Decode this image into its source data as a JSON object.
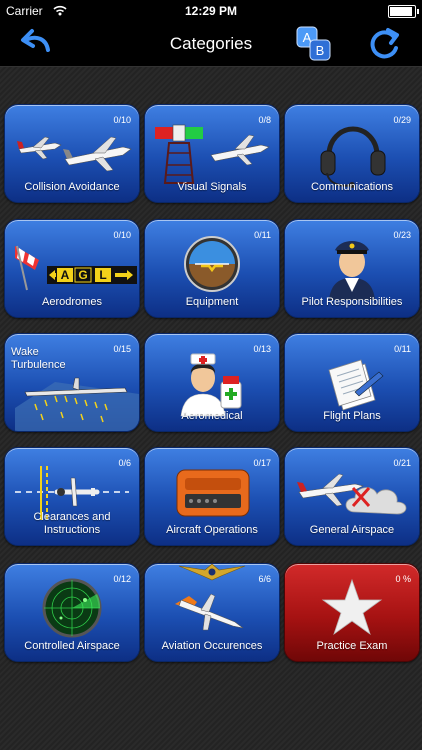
{
  "status": {
    "carrier": "Carrier",
    "time": "12:29 PM",
    "battery_level": 1.0
  },
  "nav": {
    "title": "Categories",
    "back_icon": "back-arrow-icon",
    "sort_icon": "ab-sort-icon",
    "refresh_icon": "refresh-icon"
  },
  "colors": {
    "tile_blue": "#1c4fb2",
    "tile_red": "#a61212",
    "background": "#262626"
  },
  "tiles": [
    {
      "label": "Collision Avoidance",
      "count": "0/10",
      "icon": "airplanes-icon"
    },
    {
      "label": "Visual Signals",
      "count": "0/8",
      "icon": "signal-tower-icon"
    },
    {
      "label": "Communications",
      "count": "0/29",
      "icon": "headset-icon"
    },
    {
      "label": "Aerodromes",
      "count": "0/10",
      "icon": "windsock-icon"
    },
    {
      "label": "Equipment",
      "count": "0/11",
      "icon": "attitude-indicator-icon"
    },
    {
      "label": "Pilot Responsibilities",
      "count": "0/23",
      "icon": "pilot-icon"
    },
    {
      "label": "Wake Turbulence",
      "count": "0/15",
      "icon": "wake-turbulence-icon"
    },
    {
      "label": "Aeromedical",
      "count": "0/13",
      "icon": "nurse-icon"
    },
    {
      "label": "Flight Plans",
      "count": "0/11",
      "icon": "flight-plan-icon"
    },
    {
      "label": "Clearances and Instructions",
      "count": "0/6",
      "icon": "runway-icon"
    },
    {
      "label": "Aircraft Operations",
      "count": "0/17",
      "icon": "flight-recorder-icon"
    },
    {
      "label": "General Airspace",
      "count": "0/21",
      "icon": "airplane-cloud-icon"
    },
    {
      "label": "Controlled Airspace",
      "count": "0/12",
      "icon": "radar-icon"
    },
    {
      "label": "Aviation Occurences",
      "count": "6/6",
      "icon": "crash-icon"
    },
    {
      "label": "Practice Exam",
      "count": "0 %",
      "icon": "star-icon"
    }
  ],
  "sort_badge": {
    "a": "A",
    "b": "B"
  },
  "aerodrome_sign": {
    "a": "A",
    "g": "G",
    "l": "L"
  }
}
